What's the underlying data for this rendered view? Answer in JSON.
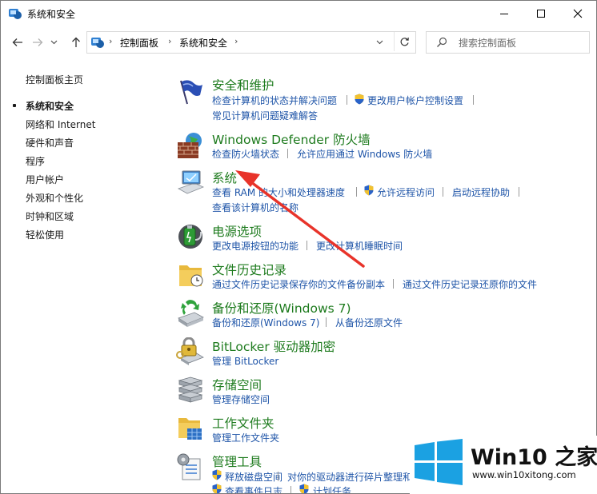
{
  "window": {
    "title": "系统和安全",
    "controls": [
      "minimize",
      "maximize",
      "close"
    ]
  },
  "address_bar": {
    "breadcrumb": [
      "控制面板",
      "系统和安全"
    ],
    "search_placeholder": "搜索控制面板"
  },
  "sidebar": {
    "items": [
      {
        "label": "控制面板主页",
        "current": false
      },
      {
        "label": "系统和安全",
        "current": true
      },
      {
        "label": "网络和 Internet",
        "current": false
      },
      {
        "label": "硬件和声音",
        "current": false
      },
      {
        "label": "程序",
        "current": false
      },
      {
        "label": "用户帐户",
        "current": false
      },
      {
        "label": "外观和个性化",
        "current": false
      },
      {
        "label": "时钟和区域",
        "current": false
      },
      {
        "label": "轻松使用",
        "current": false
      }
    ]
  },
  "categories": [
    {
      "title": "安全和维护",
      "icon": "flag-icon",
      "links": [
        "检查计算机的状态并解决问题",
        "更改用户帐户控制设置",
        "常见计算机问题疑难解答"
      ]
    },
    {
      "title": "Windows Defender 防火墙",
      "icon": "firewall-icon",
      "links": [
        "检查防火墙状态",
        "允许应用通过 Windows 防火墙"
      ]
    },
    {
      "title": "系统",
      "icon": "computer-icon",
      "links": [
        "查看 RAM 的大小和处理器速度",
        "允许远程访问",
        "启动远程协助",
        "查看该计算机的名称"
      ]
    },
    {
      "title": "电源选项",
      "icon": "battery-icon",
      "links": [
        "更改电源按钮的功能",
        "更改计算机睡眠时间"
      ]
    },
    {
      "title": "文件历史记录",
      "icon": "file-history-icon",
      "links": [
        "通过文件历史记录保存你的文件备份副本",
        "通过文件历史记录还原你的文件"
      ]
    },
    {
      "title": "备份和还原(Windows 7)",
      "icon": "backup-icon",
      "links": [
        "备份和还原(Windows 7)",
        "从备份还原文件"
      ]
    },
    {
      "title": "BitLocker 驱动器加密",
      "icon": "bitlocker-icon",
      "links": [
        "管理 BitLocker"
      ]
    },
    {
      "title": "存储空间",
      "icon": "storage-icon",
      "links": [
        "管理存储空间"
      ]
    },
    {
      "title": "工作文件夹",
      "icon": "work-folders-icon",
      "links": [
        "管理工作文件夹"
      ]
    },
    {
      "title": "管理工具",
      "icon": "admin-tools-icon",
      "links": [
        "释放磁盘空间",
        "对你的驱动器进行碎片整理和",
        "查看事件日志",
        "计划任务"
      ]
    }
  ],
  "watermark": {
    "brand": "Win10 之家",
    "url": "www.win10xitong.com"
  },
  "colors": {
    "title_green": "#1e7b1e",
    "link_blue": "#1f55a8",
    "annotation_arrow": "#e8332a",
    "watermark_blue": "#1ba1e2"
  }
}
